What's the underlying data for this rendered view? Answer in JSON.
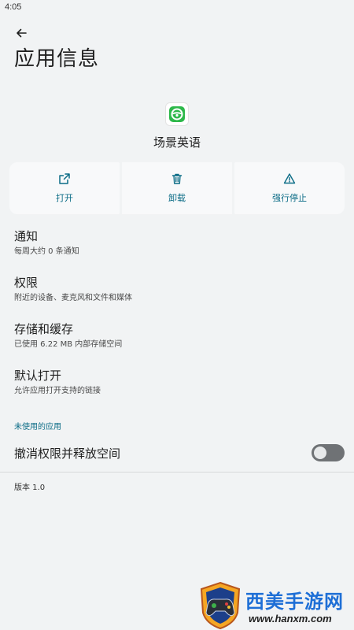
{
  "status_bar": {
    "time": "4:05"
  },
  "header": {
    "title": "应用信息"
  },
  "app": {
    "name": "场景英语",
    "icon": "steering-wheel-app-icon"
  },
  "actions": [
    {
      "label": "打开",
      "icon": "open-external-icon"
    },
    {
      "label": "卸载",
      "icon": "trash-icon"
    },
    {
      "label": "强行停止",
      "icon": "warning-triangle-icon"
    }
  ],
  "settings": [
    {
      "title": "通知",
      "subtitle": "每周大约 0 条通知"
    },
    {
      "title": "权限",
      "subtitle": "附近的设备、麦克风和文件和媒体"
    },
    {
      "title": "存储和缓存",
      "subtitle": "已使用 6.22 MB 内部存储空间"
    },
    {
      "title": "默认打开",
      "subtitle": "允许应用打开支持的链接"
    }
  ],
  "unused_section": {
    "header": "未使用的应用",
    "toggle_label": "撤消权限并释放空间",
    "toggle_on": false
  },
  "footer": {
    "version": "版本 1.0"
  },
  "watermark": {
    "text": "西美手游网",
    "url": "www.hanxm.com"
  },
  "colors": {
    "accent": "#0b6c86",
    "background": "#f1f3f4",
    "card": "#f8f9fa",
    "app_icon_green": "#2db84a"
  }
}
